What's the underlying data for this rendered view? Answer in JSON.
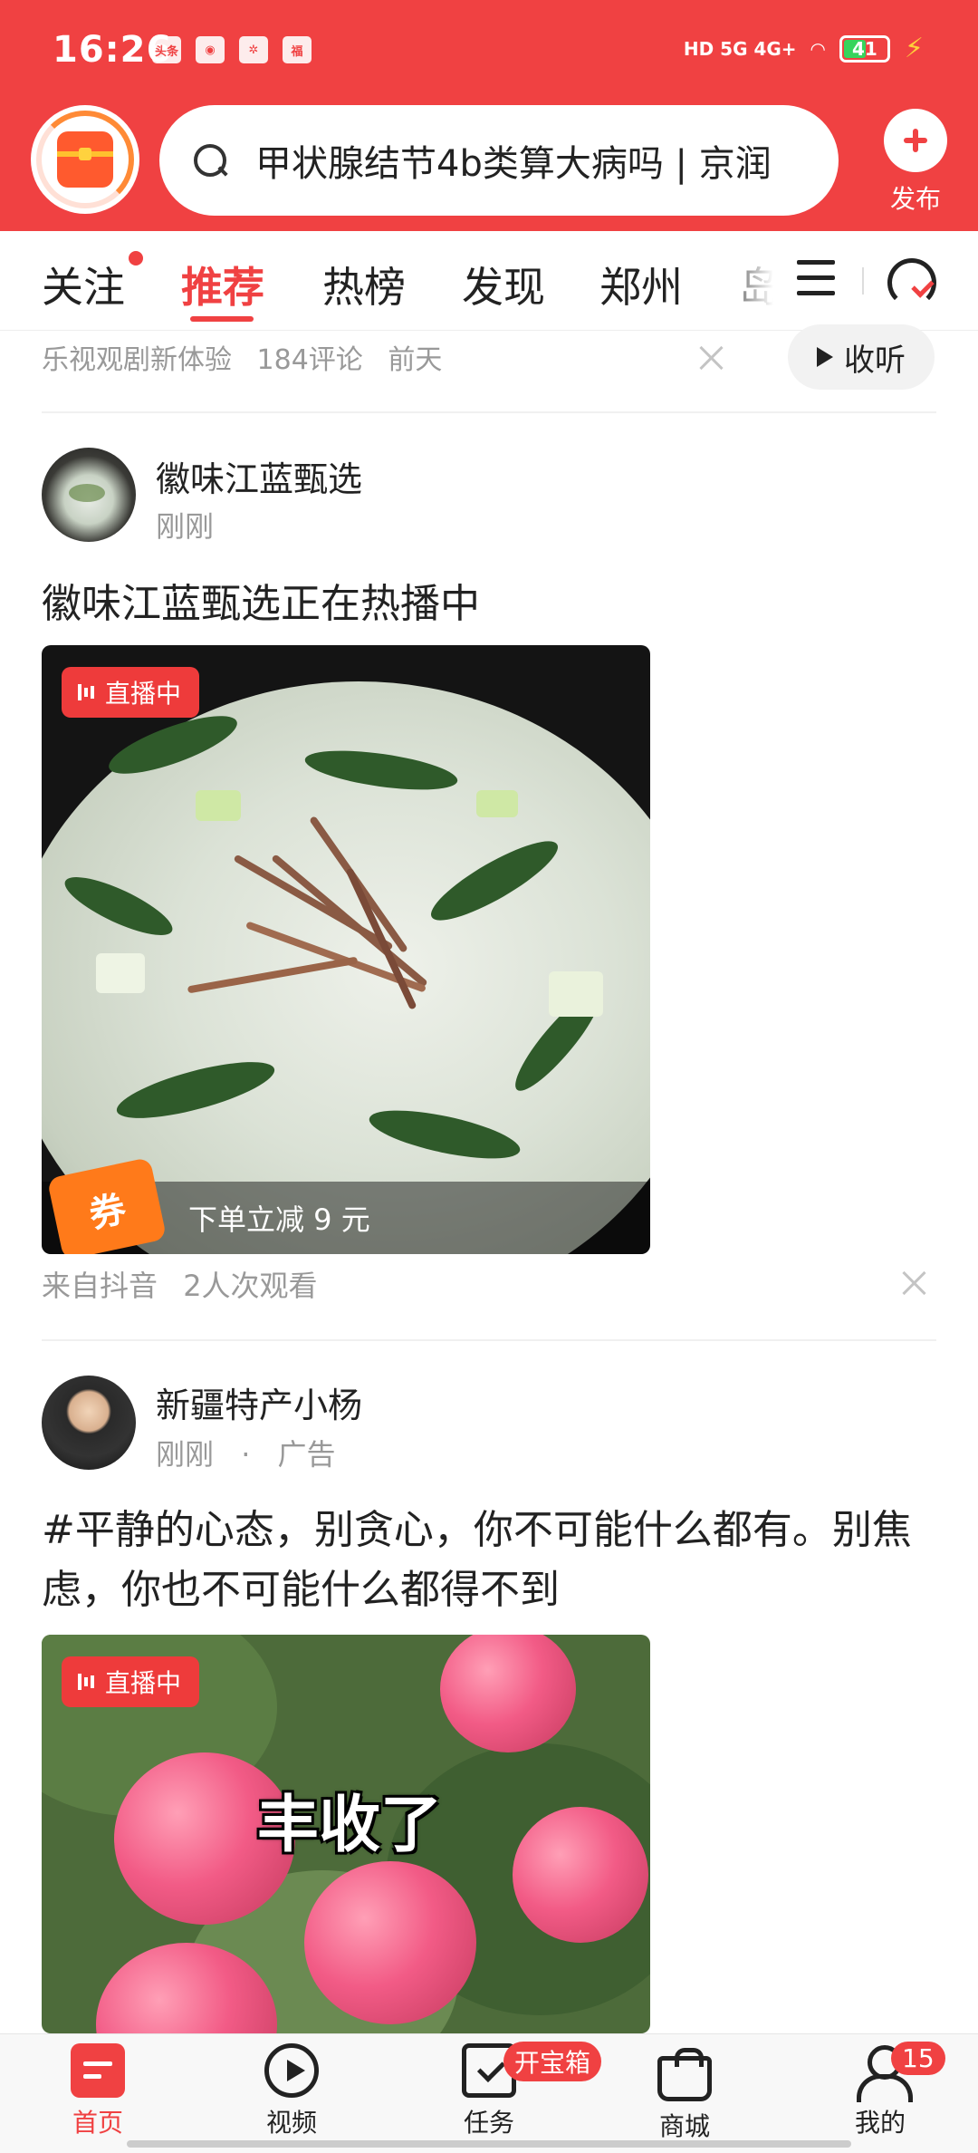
{
  "status_bar": {
    "time": "16:26",
    "app_icons": [
      "头条",
      "◉",
      "✲",
      "福"
    ],
    "network": "HD 5G 4G+",
    "battery_level": "41"
  },
  "header": {
    "search_text": "甲状腺结节4b类算大病吗 | 京润",
    "publish_label": "发布"
  },
  "tabs": [
    "关注",
    "推荐",
    "热榜",
    "发现",
    "郑州",
    "岛"
  ],
  "tabs_active_index": 1,
  "colors": {
    "brand_red": "#f04142",
    "badge_red": "#ee3b3b",
    "coupon_orange": "#ff7a1a"
  },
  "prev_item": {
    "source": "乐视观剧新体验",
    "comments": "184评论",
    "time": "前天",
    "listen_label": "收听"
  },
  "posts": [
    {
      "author": "徽味江蓝甄选",
      "time": "刚刚",
      "title": "徽味江蓝甄选正在热播中",
      "live_label": "直播中",
      "coupon_icon": "券",
      "coupon_text": "下单立减 9 元",
      "source": "来自抖音",
      "views": "2人次观看"
    },
    {
      "author": "新疆特产小杨",
      "time": "刚刚",
      "separator": "·",
      "tag": "广告",
      "title": "#平静的心态，别贪心，你不可能什么都有。别焦虑，你也不可能什么都得不到",
      "live_label": "直播中",
      "overlay_text": "丰收了"
    }
  ],
  "bottom_nav": {
    "items": [
      {
        "label": "首页",
        "icon": "home-icon"
      },
      {
        "label": "视频",
        "icon": "video-play-icon"
      },
      {
        "label": "任务",
        "icon": "task-calendar-icon"
      },
      {
        "label": "商城",
        "icon": "shopping-bag-icon"
      },
      {
        "label": "我的",
        "icon": "user-icon"
      }
    ],
    "active_index": 0,
    "task_badge": "开宝箱",
    "mine_badge": "15"
  }
}
